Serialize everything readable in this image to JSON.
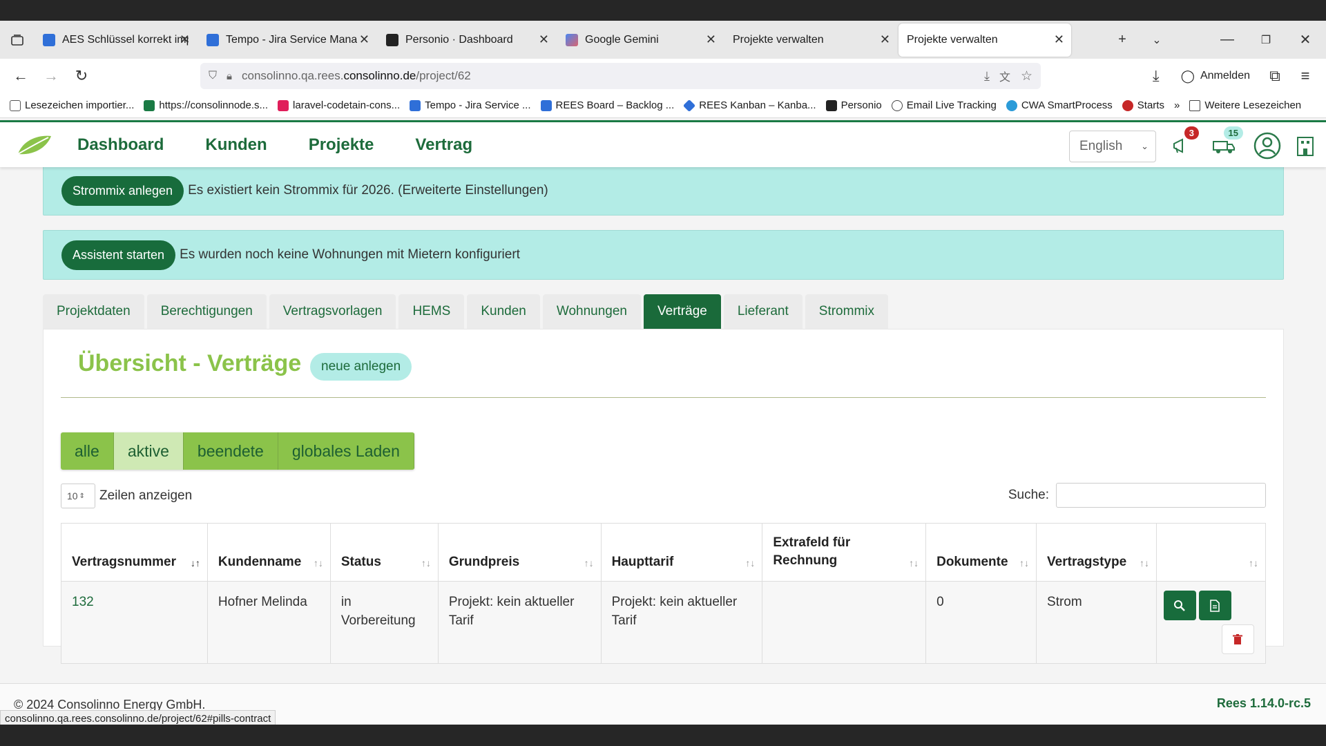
{
  "browser": {
    "tabs": [
      {
        "title": "AES Schlüssel korrekt impor",
        "favicon": "#2f6fd8"
      },
      {
        "title": "Tempo - Jira Service Manag",
        "favicon": "#2f6fd8"
      },
      {
        "title": "Personio · Dashboard",
        "favicon": "#222222"
      },
      {
        "title": "Google Gemini",
        "favicon": "#6a8cf0"
      },
      {
        "title": "Projekte verwalten",
        "favicon": ""
      },
      {
        "title": "Projekte verwalten",
        "favicon": ""
      }
    ],
    "url_prefix": "consolinno.qa.rees.",
    "url_domain": "consolinno.de",
    "url_path": "/project/62",
    "signin_label": "Anmelden",
    "bookmarks": [
      "Lesezeichen importier...",
      "https://consolinnode.s...",
      "laravel-codetain-cons...",
      "Tempo - Jira Service ...",
      "REES Board – Backlog ...",
      "REES Kanban – Kanba...",
      "Personio",
      "Email Live Tracking",
      "CWA SmartProcess",
      "Starts"
    ],
    "other_bookmarks": "Weitere Lesezeichen",
    "status_url": "consolinno.qa.rees.consolinno.de/project/62#pills-contract"
  },
  "app": {
    "nav": [
      "Dashboard",
      "Kunden",
      "Projekte",
      "Vertrag"
    ],
    "language": "English",
    "notifications_count": "3",
    "messages_count": "15",
    "alerts": [
      {
        "button": "Strommix anlegen",
        "text": "Es existiert kein Strommix für 2026. (Erweiterte Einstellungen)"
      },
      {
        "button": "Assistent starten",
        "text": "Es wurden noch keine Wohnungen mit Mietern konfiguriert"
      }
    ],
    "tabs": [
      "Projektdaten",
      "Berechtigungen",
      "Vertragsvorlagen",
      "HEMS",
      "Kunden",
      "Wohnungen",
      "Verträge",
      "Lieferant",
      "Strommix"
    ],
    "active_tab": "Verträge",
    "panel_title": "Übersicht - Verträge",
    "new_button": "neue anlegen",
    "filters": [
      "alle",
      "aktive",
      "beendete",
      "globales Laden"
    ],
    "selected_filter": "aktive",
    "rows_value": "10",
    "rows_label": "Zeilen anzeigen",
    "search_label": "Suche:",
    "table": {
      "headers": [
        "Vertragsnummer",
        "Kundenname",
        "Status",
        "Grundpreis",
        "Haupttarif",
        "Extrafeld für Rechnung",
        "Dokumente",
        "Vertragstype",
        ""
      ],
      "rows": [
        {
          "nr": "132",
          "name": "Hofner Melinda",
          "status": "in Vorbereitung",
          "grundpreis": "Projekt: kein aktueller Tarif",
          "haupttarif": "Projekt: kein aktueller Tarif",
          "extra": "",
          "docs": "0",
          "type": "Strom"
        }
      ]
    },
    "footer_copy": "© 2024 Consolinno Energy GmbH.",
    "version": "Rees 1.14.0-rc.5",
    "brand_color": "#1a6a3a",
    "accent_color": "#8bc34a"
  }
}
